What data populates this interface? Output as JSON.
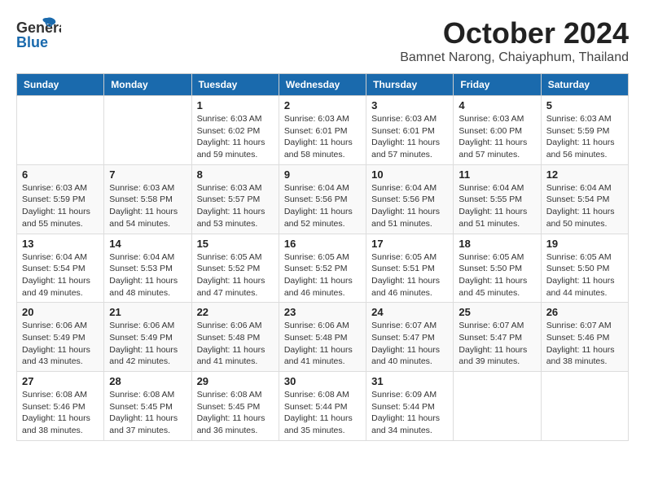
{
  "header": {
    "logo_general": "General",
    "logo_blue": "Blue",
    "month": "October 2024",
    "location": "Bamnet Narong, Chaiyaphum, Thailand"
  },
  "weekdays": [
    "Sunday",
    "Monday",
    "Tuesday",
    "Wednesday",
    "Thursday",
    "Friday",
    "Saturday"
  ],
  "weeks": [
    [
      {
        "day": "",
        "sunrise": "",
        "sunset": "",
        "daylight": ""
      },
      {
        "day": "",
        "sunrise": "",
        "sunset": "",
        "daylight": ""
      },
      {
        "day": "1",
        "sunrise": "Sunrise: 6:03 AM",
        "sunset": "Sunset: 6:02 PM",
        "daylight": "Daylight: 11 hours and 59 minutes."
      },
      {
        "day": "2",
        "sunrise": "Sunrise: 6:03 AM",
        "sunset": "Sunset: 6:01 PM",
        "daylight": "Daylight: 11 hours and 58 minutes."
      },
      {
        "day": "3",
        "sunrise": "Sunrise: 6:03 AM",
        "sunset": "Sunset: 6:01 PM",
        "daylight": "Daylight: 11 hours and 57 minutes."
      },
      {
        "day": "4",
        "sunrise": "Sunrise: 6:03 AM",
        "sunset": "Sunset: 6:00 PM",
        "daylight": "Daylight: 11 hours and 57 minutes."
      },
      {
        "day": "5",
        "sunrise": "Sunrise: 6:03 AM",
        "sunset": "Sunset: 5:59 PM",
        "daylight": "Daylight: 11 hours and 56 minutes."
      }
    ],
    [
      {
        "day": "6",
        "sunrise": "Sunrise: 6:03 AM",
        "sunset": "Sunset: 5:59 PM",
        "daylight": "Daylight: 11 hours and 55 minutes."
      },
      {
        "day": "7",
        "sunrise": "Sunrise: 6:03 AM",
        "sunset": "Sunset: 5:58 PM",
        "daylight": "Daylight: 11 hours and 54 minutes."
      },
      {
        "day": "8",
        "sunrise": "Sunrise: 6:03 AM",
        "sunset": "Sunset: 5:57 PM",
        "daylight": "Daylight: 11 hours and 53 minutes."
      },
      {
        "day": "9",
        "sunrise": "Sunrise: 6:04 AM",
        "sunset": "Sunset: 5:56 PM",
        "daylight": "Daylight: 11 hours and 52 minutes."
      },
      {
        "day": "10",
        "sunrise": "Sunrise: 6:04 AM",
        "sunset": "Sunset: 5:56 PM",
        "daylight": "Daylight: 11 hours and 51 minutes."
      },
      {
        "day": "11",
        "sunrise": "Sunrise: 6:04 AM",
        "sunset": "Sunset: 5:55 PM",
        "daylight": "Daylight: 11 hours and 51 minutes."
      },
      {
        "day": "12",
        "sunrise": "Sunrise: 6:04 AM",
        "sunset": "Sunset: 5:54 PM",
        "daylight": "Daylight: 11 hours and 50 minutes."
      }
    ],
    [
      {
        "day": "13",
        "sunrise": "Sunrise: 6:04 AM",
        "sunset": "Sunset: 5:54 PM",
        "daylight": "Daylight: 11 hours and 49 minutes."
      },
      {
        "day": "14",
        "sunrise": "Sunrise: 6:04 AM",
        "sunset": "Sunset: 5:53 PM",
        "daylight": "Daylight: 11 hours and 48 minutes."
      },
      {
        "day": "15",
        "sunrise": "Sunrise: 6:05 AM",
        "sunset": "Sunset: 5:52 PM",
        "daylight": "Daylight: 11 hours and 47 minutes."
      },
      {
        "day": "16",
        "sunrise": "Sunrise: 6:05 AM",
        "sunset": "Sunset: 5:52 PM",
        "daylight": "Daylight: 11 hours and 46 minutes."
      },
      {
        "day": "17",
        "sunrise": "Sunrise: 6:05 AM",
        "sunset": "Sunset: 5:51 PM",
        "daylight": "Daylight: 11 hours and 46 minutes."
      },
      {
        "day": "18",
        "sunrise": "Sunrise: 6:05 AM",
        "sunset": "Sunset: 5:50 PM",
        "daylight": "Daylight: 11 hours and 45 minutes."
      },
      {
        "day": "19",
        "sunrise": "Sunrise: 6:05 AM",
        "sunset": "Sunset: 5:50 PM",
        "daylight": "Daylight: 11 hours and 44 minutes."
      }
    ],
    [
      {
        "day": "20",
        "sunrise": "Sunrise: 6:06 AM",
        "sunset": "Sunset: 5:49 PM",
        "daylight": "Daylight: 11 hours and 43 minutes."
      },
      {
        "day": "21",
        "sunrise": "Sunrise: 6:06 AM",
        "sunset": "Sunset: 5:49 PM",
        "daylight": "Daylight: 11 hours and 42 minutes."
      },
      {
        "day": "22",
        "sunrise": "Sunrise: 6:06 AM",
        "sunset": "Sunset: 5:48 PM",
        "daylight": "Daylight: 11 hours and 41 minutes."
      },
      {
        "day": "23",
        "sunrise": "Sunrise: 6:06 AM",
        "sunset": "Sunset: 5:48 PM",
        "daylight": "Daylight: 11 hours and 41 minutes."
      },
      {
        "day": "24",
        "sunrise": "Sunrise: 6:07 AM",
        "sunset": "Sunset: 5:47 PM",
        "daylight": "Daylight: 11 hours and 40 minutes."
      },
      {
        "day": "25",
        "sunrise": "Sunrise: 6:07 AM",
        "sunset": "Sunset: 5:47 PM",
        "daylight": "Daylight: 11 hours and 39 minutes."
      },
      {
        "day": "26",
        "sunrise": "Sunrise: 6:07 AM",
        "sunset": "Sunset: 5:46 PM",
        "daylight": "Daylight: 11 hours and 38 minutes."
      }
    ],
    [
      {
        "day": "27",
        "sunrise": "Sunrise: 6:08 AM",
        "sunset": "Sunset: 5:46 PM",
        "daylight": "Daylight: 11 hours and 38 minutes."
      },
      {
        "day": "28",
        "sunrise": "Sunrise: 6:08 AM",
        "sunset": "Sunset: 5:45 PM",
        "daylight": "Daylight: 11 hours and 37 minutes."
      },
      {
        "day": "29",
        "sunrise": "Sunrise: 6:08 AM",
        "sunset": "Sunset: 5:45 PM",
        "daylight": "Daylight: 11 hours and 36 minutes."
      },
      {
        "day": "30",
        "sunrise": "Sunrise: 6:08 AM",
        "sunset": "Sunset: 5:44 PM",
        "daylight": "Daylight: 11 hours and 35 minutes."
      },
      {
        "day": "31",
        "sunrise": "Sunrise: 6:09 AM",
        "sunset": "Sunset: 5:44 PM",
        "daylight": "Daylight: 11 hours and 34 minutes."
      },
      {
        "day": "",
        "sunrise": "",
        "sunset": "",
        "daylight": ""
      },
      {
        "day": "",
        "sunrise": "",
        "sunset": "",
        "daylight": ""
      }
    ]
  ]
}
